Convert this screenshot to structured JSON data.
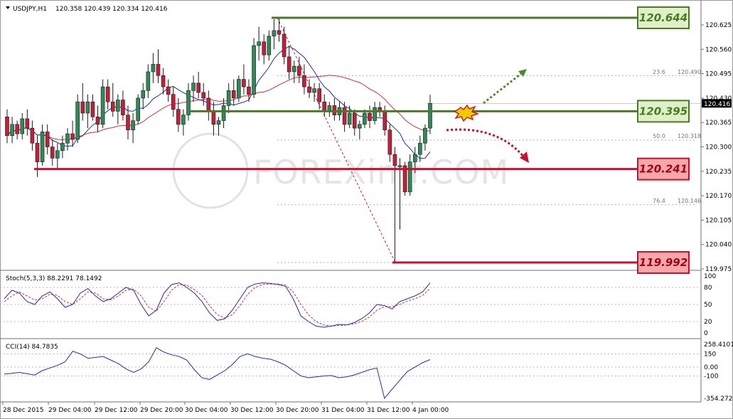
{
  "header": {
    "symbol": "USDJPY,H1",
    "ohlc": "120.358 120.439 120.334 120.416"
  },
  "watermark": "FOREXimf.COM",
  "colors": {
    "bull": "#2e8b57",
    "bear": "#c41e3a",
    "ma_fast": "#1f2fa8",
    "ma_slow": "#d43030",
    "support_green": "#4a7a24",
    "support_red": "#c8102e",
    "box_green_fill": "#dff0c8",
    "box_red_fill": "#f4a8a8",
    "stoch_main": "#1f2fa8",
    "stoch_signal": "#d43030"
  },
  "price_axis": {
    "ticks": [
      "120.625",
      "120.560",
      "120.495",
      "120.430",
      "120.365",
      "120.300",
      "120.235",
      "120.170",
      "120.105",
      "120.040",
      "119.975"
    ],
    "current": "120.416"
  },
  "levels": [
    {
      "label": "120.644",
      "value": 120.644,
      "color": "green"
    },
    {
      "label": "120.395",
      "value": 120.395,
      "color": "green"
    },
    {
      "label": "120.241",
      "value": 120.241,
      "color": "red"
    },
    {
      "label": "119.992",
      "value": 119.992,
      "color": "red"
    }
  ],
  "fib_labels": [
    {
      "ratio": "23.6",
      "value": "120.490"
    },
    {
      "ratio": "50.0",
      "value": "120.318"
    },
    {
      "ratio": "76.4",
      "value": "120.146"
    }
  ],
  "stoch": {
    "title": "Stoch(5,3,3) 88.2291 78.1492",
    "ticks": [
      "100",
      "80",
      "50",
      "20",
      "0"
    ]
  },
  "cci": {
    "title": "CCI(14) 84.7835",
    "ticks": [
      "258.4101",
      "150",
      "0.00",
      "-100",
      "-354.2724"
    ]
  },
  "time_axis": [
    "28 Dec 2015",
    "29 Dec 04:00",
    "29 Dec 12:00",
    "29 Dec 20:00",
    "30 Dec 04:00",
    "30 Dec 12:00",
    "30 Dec 20:00",
    "31 Dec 04:00",
    "31 Dec 12:00",
    "4 Jan 00:00"
  ],
  "chart_data": {
    "type": "candlestick",
    "symbol": "USDJPY",
    "timeframe": "H1",
    "ylim": [
      119.975,
      120.665
    ],
    "candles": [
      {
        "o": 120.38,
        "h": 120.4,
        "l": 120.31,
        "c": 120.33
      },
      {
        "o": 120.33,
        "h": 120.38,
        "l": 120.31,
        "c": 120.36
      },
      {
        "o": 120.36,
        "h": 120.37,
        "l": 120.32,
        "c": 120.335
      },
      {
        "o": 120.335,
        "h": 120.39,
        "l": 120.32,
        "c": 120.375
      },
      {
        "o": 120.375,
        "h": 120.4,
        "l": 120.33,
        "c": 120.35
      },
      {
        "o": 120.35,
        "h": 120.37,
        "l": 120.29,
        "c": 120.31
      },
      {
        "o": 120.31,
        "h": 120.33,
        "l": 120.22,
        "c": 120.26
      },
      {
        "o": 120.26,
        "h": 120.36,
        "l": 120.25,
        "c": 120.34
      },
      {
        "o": 120.34,
        "h": 120.36,
        "l": 120.28,
        "c": 120.3
      },
      {
        "o": 120.3,
        "h": 120.32,
        "l": 120.25,
        "c": 120.27
      },
      {
        "o": 120.27,
        "h": 120.31,
        "l": 120.24,
        "c": 120.29
      },
      {
        "o": 120.29,
        "h": 120.33,
        "l": 120.27,
        "c": 120.31
      },
      {
        "o": 120.31,
        "h": 120.35,
        "l": 120.29,
        "c": 120.335
      },
      {
        "o": 120.335,
        "h": 120.37,
        "l": 120.3,
        "c": 120.32
      },
      {
        "o": 120.32,
        "h": 120.44,
        "l": 120.31,
        "c": 120.42
      },
      {
        "o": 120.42,
        "h": 120.47,
        "l": 120.37,
        "c": 120.39
      },
      {
        "o": 120.39,
        "h": 120.44,
        "l": 120.35,
        "c": 120.42
      },
      {
        "o": 120.42,
        "h": 120.44,
        "l": 120.37,
        "c": 120.38
      },
      {
        "o": 120.38,
        "h": 120.41,
        "l": 120.34,
        "c": 120.36
      },
      {
        "o": 120.36,
        "h": 120.48,
        "l": 120.35,
        "c": 120.46
      },
      {
        "o": 120.46,
        "h": 120.48,
        "l": 120.4,
        "c": 120.42
      },
      {
        "o": 120.42,
        "h": 120.47,
        "l": 120.38,
        "c": 120.395
      },
      {
        "o": 120.395,
        "h": 120.44,
        "l": 120.36,
        "c": 120.425
      },
      {
        "o": 120.425,
        "h": 120.45,
        "l": 120.37,
        "c": 120.385
      },
      {
        "o": 120.385,
        "h": 120.41,
        "l": 120.32,
        "c": 120.345
      },
      {
        "o": 120.345,
        "h": 120.39,
        "l": 120.31,
        "c": 120.37
      },
      {
        "o": 120.37,
        "h": 120.44,
        "l": 120.36,
        "c": 120.43
      },
      {
        "o": 120.43,
        "h": 120.47,
        "l": 120.4,
        "c": 120.45
      },
      {
        "o": 120.45,
        "h": 120.52,
        "l": 120.43,
        "c": 120.5
      },
      {
        "o": 120.5,
        "h": 120.55,
        "l": 120.47,
        "c": 120.52
      },
      {
        "o": 120.52,
        "h": 120.56,
        "l": 120.47,
        "c": 120.49
      },
      {
        "o": 120.49,
        "h": 120.51,
        "l": 120.44,
        "c": 120.46
      },
      {
        "o": 120.46,
        "h": 120.48,
        "l": 120.42,
        "c": 120.44
      },
      {
        "o": 120.44,
        "h": 120.46,
        "l": 120.38,
        "c": 120.4
      },
      {
        "o": 120.4,
        "h": 120.43,
        "l": 120.34,
        "c": 120.36
      },
      {
        "o": 120.36,
        "h": 120.4,
        "l": 120.33,
        "c": 120.385
      },
      {
        "o": 120.385,
        "h": 120.47,
        "l": 120.37,
        "c": 120.45
      },
      {
        "o": 120.45,
        "h": 120.49,
        "l": 120.42,
        "c": 120.47
      },
      {
        "o": 120.47,
        "h": 120.5,
        "l": 120.43,
        "c": 120.445
      },
      {
        "o": 120.445,
        "h": 120.47,
        "l": 120.41,
        "c": 120.43
      },
      {
        "o": 120.43,
        "h": 120.45,
        "l": 120.37,
        "c": 120.395
      },
      {
        "o": 120.395,
        "h": 120.42,
        "l": 120.33,
        "c": 120.36
      },
      {
        "o": 120.36,
        "h": 120.38,
        "l": 120.33,
        "c": 120.37
      },
      {
        "o": 120.37,
        "h": 120.43,
        "l": 120.35,
        "c": 120.41
      },
      {
        "o": 120.41,
        "h": 120.47,
        "l": 120.39,
        "c": 120.45
      },
      {
        "o": 120.45,
        "h": 120.48,
        "l": 120.41,
        "c": 120.43
      },
      {
        "o": 120.43,
        "h": 120.49,
        "l": 120.42,
        "c": 120.48
      },
      {
        "o": 120.48,
        "h": 120.52,
        "l": 120.44,
        "c": 120.46
      },
      {
        "o": 120.46,
        "h": 120.48,
        "l": 120.42,
        "c": 120.44
      },
      {
        "o": 120.44,
        "h": 120.59,
        "l": 120.43,
        "c": 120.57
      },
      {
        "o": 120.57,
        "h": 120.62,
        "l": 120.53,
        "c": 120.58
      },
      {
        "o": 120.58,
        "h": 120.6,
        "l": 120.52,
        "c": 120.545
      },
      {
        "o": 120.545,
        "h": 120.61,
        "l": 120.53,
        "c": 120.595
      },
      {
        "o": 120.595,
        "h": 120.64,
        "l": 120.56,
        "c": 120.61
      },
      {
        "o": 120.61,
        "h": 120.644,
        "l": 120.58,
        "c": 120.6
      },
      {
        "o": 120.6,
        "h": 120.62,
        "l": 120.52,
        "c": 120.54
      },
      {
        "o": 120.54,
        "h": 120.57,
        "l": 120.48,
        "c": 120.5
      },
      {
        "o": 120.5,
        "h": 120.53,
        "l": 120.47,
        "c": 120.515
      },
      {
        "o": 120.515,
        "h": 120.54,
        "l": 120.47,
        "c": 120.49
      },
      {
        "o": 120.49,
        "h": 120.52,
        "l": 120.44,
        "c": 120.46
      },
      {
        "o": 120.46,
        "h": 120.48,
        "l": 120.43,
        "c": 120.445
      },
      {
        "o": 120.445,
        "h": 120.47,
        "l": 120.42,
        "c": 120.455
      },
      {
        "o": 120.455,
        "h": 120.47,
        "l": 120.4,
        "c": 120.42
      },
      {
        "o": 120.42,
        "h": 120.44,
        "l": 120.38,
        "c": 120.395
      },
      {
        "o": 120.395,
        "h": 120.42,
        "l": 120.38,
        "c": 120.41
      },
      {
        "o": 120.41,
        "h": 120.43,
        "l": 120.37,
        "c": 120.385
      },
      {
        "o": 120.385,
        "h": 120.42,
        "l": 120.37,
        "c": 120.405
      },
      {
        "o": 120.405,
        "h": 120.42,
        "l": 120.34,
        "c": 120.36
      },
      {
        "o": 120.36,
        "h": 120.41,
        "l": 120.35,
        "c": 120.39
      },
      {
        "o": 120.39,
        "h": 120.4,
        "l": 120.33,
        "c": 120.35
      },
      {
        "o": 120.35,
        "h": 120.37,
        "l": 120.32,
        "c": 120.36
      },
      {
        "o": 120.36,
        "h": 120.4,
        "l": 120.35,
        "c": 120.39
      },
      {
        "o": 120.39,
        "h": 120.41,
        "l": 120.35,
        "c": 120.37
      },
      {
        "o": 120.37,
        "h": 120.42,
        "l": 120.36,
        "c": 120.405
      },
      {
        "o": 120.405,
        "h": 120.42,
        "l": 120.38,
        "c": 120.395
      },
      {
        "o": 120.395,
        "h": 120.41,
        "l": 120.33,
        "c": 120.345
      },
      {
        "o": 120.345,
        "h": 120.36,
        "l": 120.26,
        "c": 120.28
      },
      {
        "o": 120.28,
        "h": 120.3,
        "l": 119.992,
        "c": 120.25
      },
      {
        "o": 120.25,
        "h": 120.27,
        "l": 120.08,
        "c": 120.25
      },
      {
        "o": 120.25,
        "h": 120.26,
        "l": 120.17,
        "c": 120.18
      },
      {
        "o": 120.18,
        "h": 120.28,
        "l": 120.17,
        "c": 120.26
      },
      {
        "o": 120.26,
        "h": 120.3,
        "l": 120.23,
        "c": 120.28
      },
      {
        "o": 120.28,
        "h": 120.33,
        "l": 120.26,
        "c": 120.31
      },
      {
        "o": 120.31,
        "h": 120.36,
        "l": 120.29,
        "c": 120.35
      },
      {
        "o": 120.35,
        "h": 120.439,
        "l": 120.334,
        "c": 120.416
      }
    ],
    "stoch_main": [
      60,
      75,
      70,
      55,
      50,
      65,
      72,
      60,
      45,
      50,
      70,
      78,
      65,
      55,
      60,
      70,
      80,
      75,
      50,
      30,
      40,
      70,
      85,
      88,
      80,
      70,
      55,
      35,
      22,
      25,
      40,
      60,
      80,
      86,
      88,
      87,
      85,
      82,
      60,
      30,
      20,
      12,
      10,
      12,
      15,
      14,
      18,
      25,
      35,
      50,
      48,
      42,
      55,
      60,
      65,
      72,
      88
    ],
    "stoch_signal": [
      55,
      65,
      72,
      65,
      58,
      60,
      68,
      66,
      55,
      50,
      60,
      72,
      70,
      60,
      58,
      65,
      75,
      77,
      65,
      45,
      38,
      55,
      75,
      85,
      84,
      76,
      66,
      48,
      32,
      26,
      32,
      48,
      68,
      80,
      85,
      86,
      86,
      84,
      72,
      50,
      32,
      20,
      14,
      12,
      13,
      14,
      16,
      20,
      28,
      40,
      46,
      46,
      50,
      56,
      60,
      66,
      78
    ],
    "cci": [
      -80,
      -70,
      -60,
      -75,
      -90,
      -40,
      -10,
      20,
      60,
      180,
      150,
      100,
      110,
      120,
      80,
      40,
      -20,
      -60,
      -20,
      60,
      220,
      170,
      140,
      120,
      80,
      -30,
      -120,
      -140,
      -90,
      -40,
      30,
      120,
      150,
      120,
      100,
      90,
      60,
      20,
      -40,
      -100,
      -120,
      -110,
      -100,
      -95,
      -120,
      -110,
      -90,
      -60,
      -30,
      -10,
      -354,
      -250,
      -150,
      -50,
      0,
      50,
      85
    ]
  }
}
